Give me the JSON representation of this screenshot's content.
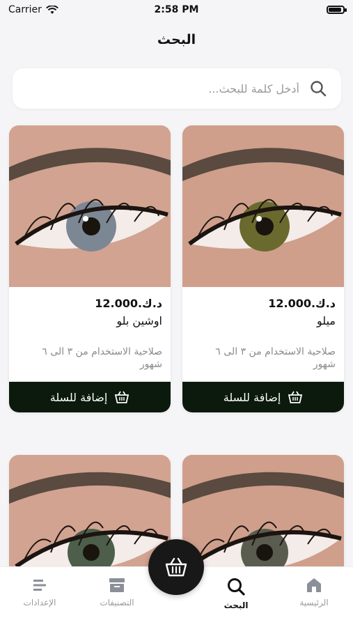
{
  "status_bar": {
    "carrier": "Carrier",
    "time": "2:58 PM"
  },
  "header": {
    "title": "البحث"
  },
  "search": {
    "placeholder": "أدخل كلمة للبحث..."
  },
  "products": [
    {
      "price": "د.ك.12.000",
      "name": "ميلو",
      "description": "صلاحية الاستخدام من ٣ الى ٦ شهور",
      "add_label": "إضافة للسلة",
      "iris_color": "#6b6a2e"
    },
    {
      "price": "د.ك.12.000",
      "name": "اوشين بلو",
      "description": "صلاحية الاستخدام من ٣ الى ٦ شهور",
      "add_label": "إضافة للسلة",
      "iris_color": "#7c8794"
    },
    {
      "iris_color": "#5a5c50"
    },
    {
      "iris_color": "#4d5e4a"
    }
  ],
  "tabbar": {
    "items": [
      {
        "label": "الرئيسية",
        "icon": "home-icon"
      },
      {
        "label": "البحث",
        "icon": "search-icon"
      },
      {
        "label": "التصنيفات",
        "icon": "categories-icon"
      },
      {
        "label": "الإعدادات",
        "icon": "settings-icon"
      }
    ],
    "active": "البحث"
  },
  "colors": {
    "accent": "#0b1a0c",
    "fab": "#181818"
  }
}
